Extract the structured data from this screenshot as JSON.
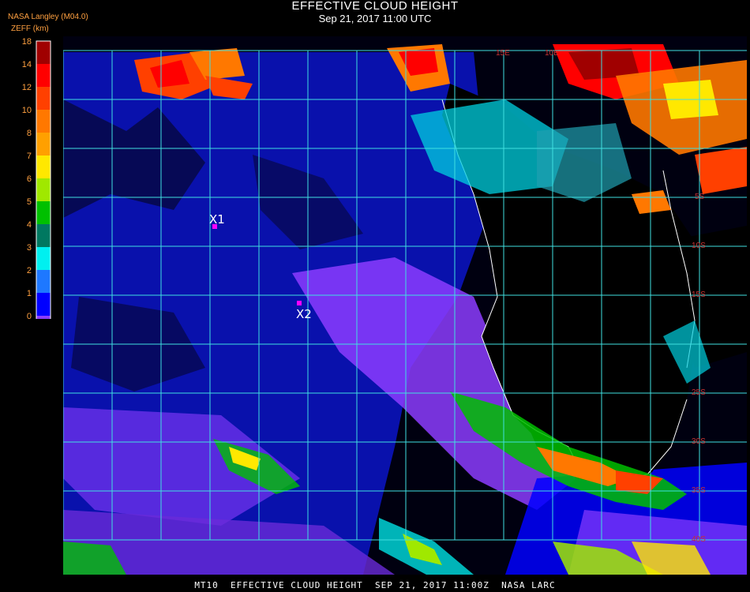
{
  "header": {
    "title": "EFFECTIVE CLOUD HEIGHT",
    "subtitle": "Sep 21, 2017 11:00 UTC",
    "provider": "NASA Langley (M04.0)",
    "unit": "ZEFF (km)"
  },
  "legend": {
    "ticks": [
      "18",
      "14",
      "12",
      "10",
      "8",
      "7",
      "6",
      "5",
      "4",
      "3",
      "2",
      "1",
      "0"
    ],
    "colors": [
      "#a00000",
      "#ff0000",
      "#ff4000",
      "#ff7800",
      "#ffa000",
      "#ffe800",
      "#a0e800",
      "#00c000",
      "#007860",
      "#00f0f0",
      "#1e78ff",
      "#0000ff",
      "#8c3cff"
    ]
  },
  "map": {
    "markers": [
      {
        "label": "X1",
        "color": "#ff00ff"
      },
      {
        "label": "X2",
        "color": "#ff00ff"
      }
    ],
    "lon_labels": [
      "15E",
      "10E"
    ],
    "lat_labels": [
      "5S",
      "10S",
      "15S",
      "25S",
      "30S",
      "35S",
      "40S"
    ],
    "grid_color": "#40e0e0"
  },
  "footer": {
    "caption": "MT10  EFFECTIVE CLOUD HEIGHT  SEP 21, 2017 11:00Z  NASA LARC"
  }
}
